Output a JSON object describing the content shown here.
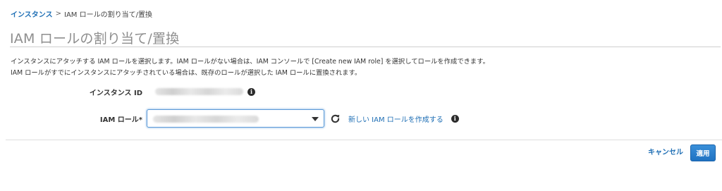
{
  "breadcrumb": {
    "parent": "インスタンス",
    "separator": ">",
    "current": "IAM ロールの割り当て/置換"
  },
  "page_title": "IAM ロールの割り当て/置換",
  "description": {
    "line1": "インスタンスにアタッチする IAM ロールを選択します。IAM ロールがない場合は、IAM コンソールで [Create new IAM role] を選択してロールを作成できます。",
    "line2": "IAM ロールがすでにインスタンスにアタッチされている場合は、既存のロールが選択した IAM ロールに置換されます。"
  },
  "form": {
    "instance_id_label": "インスタンス ID",
    "iam_role_label": "IAM ロール*",
    "create_role_link": "新しい IAM ロールを作成する",
    "info_glyph": "i"
  },
  "footer": {
    "cancel_label": "キャンセル",
    "apply_label": "適用"
  },
  "colors": {
    "link": "#1f6fb5",
    "primary_button": "#2a80cc",
    "focus_border": "#5b9ad8"
  },
  "icons": [
    "info-icon",
    "refresh-icon",
    "chevron-down-icon"
  ]
}
